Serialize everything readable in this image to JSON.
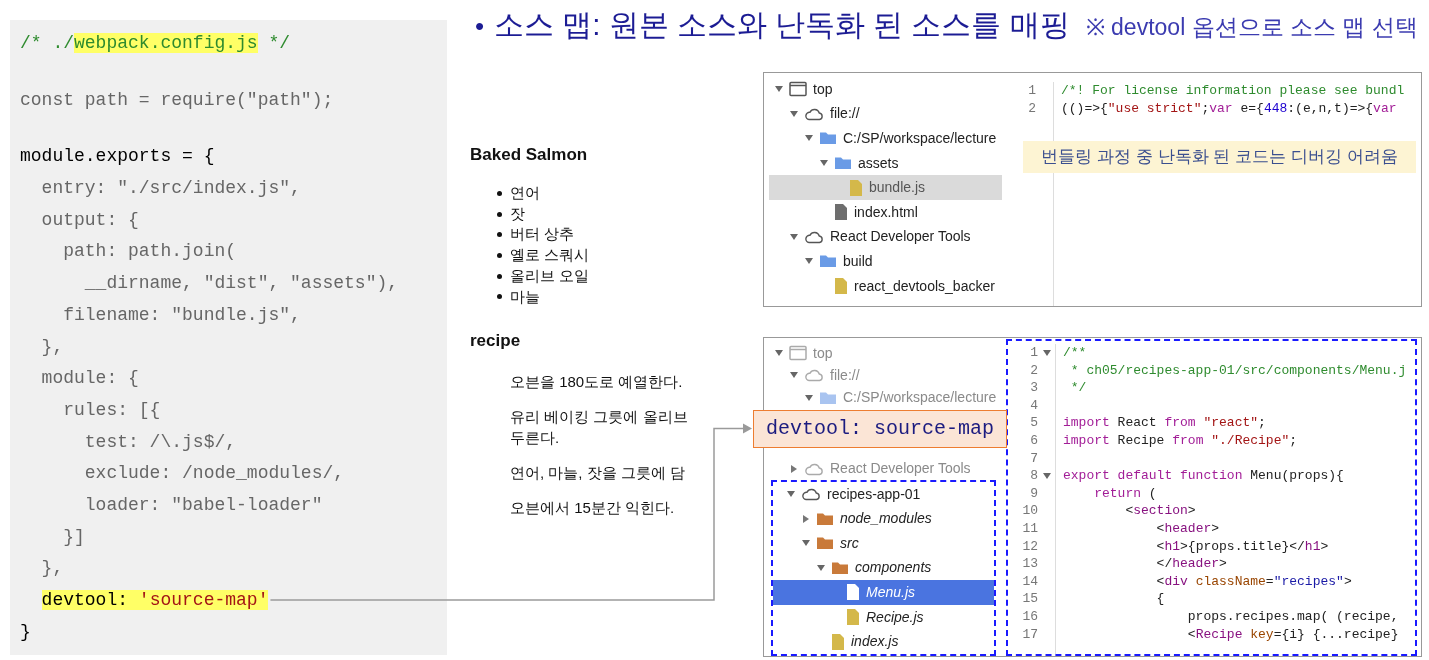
{
  "code_panel": {
    "lines": [
      {
        "tokens": [
          {
            "text": "/* ./",
            "kind": "comment"
          },
          {
            "text": "webpack.config.js",
            "kind": "comment",
            "highlighted": true
          },
          {
            "text": " */",
            "kind": "comment"
          }
        ]
      },
      {
        "kind": "blank"
      },
      {
        "tokens": [
          {
            "text": "const path = require(\"path\");",
            "kind": "dim"
          }
        ]
      },
      {
        "kind": "blank"
      },
      {
        "tokens": [
          {
            "text": "module.exports = {",
            "kind": "normal"
          }
        ]
      },
      {
        "tokens": [
          {
            "text": "  entry: \"./src/index.js\",",
            "kind": "dim"
          }
        ]
      },
      {
        "tokens": [
          {
            "text": "  output: {",
            "kind": "dim"
          }
        ]
      },
      {
        "tokens": [
          {
            "text": "    path: path.join(",
            "kind": "dim"
          }
        ]
      },
      {
        "tokens": [
          {
            "text": "      __dirname, \"dist\", \"assets\"),",
            "kind": "dim"
          }
        ]
      },
      {
        "tokens": [
          {
            "text": "    filename: \"bundle.js\",",
            "kind": "dim"
          }
        ]
      },
      {
        "tokens": [
          {
            "text": "  },",
            "kind": "dim"
          }
        ]
      },
      {
        "tokens": [
          {
            "text": "  module: {",
            "kind": "dim"
          }
        ]
      },
      {
        "tokens": [
          {
            "text": "    rules: [{",
            "kind": "dim"
          }
        ]
      },
      {
        "tokens": [
          {
            "text": "      test: /\\.js$/,",
            "kind": "dim"
          }
        ]
      },
      {
        "tokens": [
          {
            "text": "      exclude: /node_modules/,",
            "kind": "dim"
          }
        ]
      },
      {
        "tokens": [
          {
            "text": "      loader: \"babel-loader\"",
            "kind": "dim"
          }
        ]
      },
      {
        "tokens": [
          {
            "text": "    }]",
            "kind": "dim"
          }
        ]
      },
      {
        "tokens": [
          {
            "text": "  },",
            "kind": "dim"
          }
        ]
      },
      {
        "tokens": [
          {
            "text": "  devtool: ",
            "kind": "normal",
            "highlighted": true
          },
          {
            "text": "'source-map'",
            "kind": "string",
            "highlighted": true
          }
        ]
      },
      {
        "tokens": [
          {
            "text": "}",
            "kind": "normal"
          }
        ]
      }
    ]
  },
  "title": {
    "bullet": "•",
    "text": "소스 맵: 원본 소스와 난독화 된 소스를 매핑",
    "note": "※ devtool 옵션으로 소스 맵 선택"
  },
  "recipe_page": {
    "title": "Baked Salmon",
    "ingredients": [
      "연어",
      "잣",
      "버터 상추",
      "옐로 스쿼시",
      "올리브 오일",
      "마늘"
    ],
    "section_heading": "recipe",
    "steps": [
      {
        "lines": [
          "오븐을 180도로 예열한다."
        ]
      },
      {
        "lines": [
          "유리 베이킹 그릇에 올리브",
          "두른다."
        ]
      },
      {
        "lines": [
          "연어, 마늘, 잣을 그릇에 담"
        ]
      },
      {
        "lines": [
          "오븐에서 15분간 익힌다."
        ]
      }
    ]
  },
  "top_panel": {
    "focused": false,
    "nodes": [
      {
        "label": "top",
        "kind": "frame",
        "expanded": true,
        "selected": false,
        "children": [
          {
            "label": "file://",
            "kind": "cloud",
            "expanded": true,
            "selected": false,
            "children": [
              {
                "label": "C:/SP/workspace/lecture",
                "kind": "folder",
                "color": "#6a9be6",
                "expanded": true,
                "selected": false,
                "children": [
                  {
                    "label": "assets",
                    "kind": "folder",
                    "color": "#6a9be6",
                    "expanded": true,
                    "selected": false,
                    "children": [
                      {
                        "label": "bundle.js",
                        "kind": "file",
                        "color": "#d4b84a",
                        "selected": true
                      }
                    ]
                  },
                  {
                    "label": "index.html",
                    "kind": "file",
                    "color": "#6e6e6e",
                    "selected": false
                  }
                ]
              }
            ]
          },
          {
            "label": "React Developer Tools",
            "kind": "cloud",
            "expanded": true,
            "selected": false,
            "children": [
              {
                "label": "build",
                "kind": "folder",
                "color": "#6a9be6",
                "expanded": true,
                "selected": false,
                "children": [
                  {
                    "label": "react_devtools_backer",
                    "kind": "file",
                    "color": "#d4b84a",
                    "selected": false
                  }
                ]
              }
            ]
          }
        ]
      }
    ],
    "editor": {
      "note": "번들링 과정 중 난독화 된 코드는 디버깅 어려움",
      "lines": [
        {
          "number": "1",
          "tokens": [
            {
              "text": "/*! For license information please see bundl",
              "kind": "comment"
            }
          ]
        },
        {
          "number": "2",
          "tokens": [
            {
              "text": "(()=>{",
              "kind": "plain"
            },
            {
              "text": "\"use strict\"",
              "kind": "string"
            },
            {
              "text": ";",
              "kind": "plain"
            },
            {
              "text": "var",
              "kind": "keyword"
            },
            {
              "text": " e={",
              "kind": "plain"
            },
            {
              "text": "448",
              "kind": "number"
            },
            {
              "text": ":(e,n,t)=>{",
              "kind": "plain"
            },
            {
              "text": "var",
              "kind": "keyword"
            }
          ]
        }
      ]
    }
  },
  "callout": {
    "text": "devtool: source-map"
  },
  "bottom_panel": {
    "focused": true,
    "nodes": [
      {
        "label": "top",
        "kind": "frame",
        "expanded": true,
        "selected": false,
        "faded": true,
        "children": [
          {
            "label": "file://",
            "kind": "cloud",
            "expanded": true,
            "selected": false,
            "faded": true,
            "children": [
              {
                "label": "C:/SP/workspace/lecture",
                "kind": "folder",
                "color": "#a9c4f0",
                "expanded": true,
                "selected": false,
                "faded": true
              }
            ]
          },
          {
            "label": "React Developer Tools",
            "kind": "cloud",
            "expanded": false,
            "selected": false,
            "faded": true
          },
          {
            "label": "recipes-app-01",
            "kind": "cloud",
            "expanded": true,
            "selected": false,
            "framed": true,
            "children": [
              {
                "label": "node_modules",
                "kind": "folder",
                "color": "#c97a3a",
                "expanded": false,
                "selected": false,
                "source_mapped": true
              },
              {
                "label": "src",
                "kind": "folder",
                "color": "#c97a3a",
                "expanded": true,
                "selected": false,
                "source_mapped": true,
                "children": [
                  {
                    "label": "components",
                    "kind": "folder",
                    "color": "#c97a3a",
                    "expanded": true,
                    "selected": false,
                    "source_mapped": true,
                    "children": [
                      {
                        "label": "Menu.js",
                        "kind": "file",
                        "selected": true,
                        "source_mapped": true
                      },
                      {
                        "label": "Recipe.js",
                        "kind": "file",
                        "color": "#d4b84a",
                        "selected": false,
                        "source_mapped": true
                      }
                    ]
                  },
                  {
                    "label": "index.js",
                    "kind": "file",
                    "color": "#d4b84a",
                    "selected": false,
                    "source_mapped": true
                  }
                ]
              }
            ]
          }
        ]
      }
    ],
    "editor": {
      "framed": true,
      "lines": [
        {
          "number": "1",
          "foldable": true,
          "tokens": [
            {
              "text": "/**",
              "kind": "comment"
            }
          ]
        },
        {
          "number": "2",
          "foldable": false,
          "tokens": [
            {
              "text": " * ch05/recipes-app-01/src/components/Menu.j",
              "kind": "comment"
            }
          ]
        },
        {
          "number": "3",
          "foldable": false,
          "tokens": [
            {
              "text": " */",
              "kind": "comment"
            }
          ]
        },
        {
          "number": "4",
          "foldable": false
        },
        {
          "number": "5",
          "foldable": false,
          "tokens": [
            {
              "text": "import",
              "kind": "keyword"
            },
            {
              "text": " React ",
              "kind": "plain"
            },
            {
              "text": "from ",
              "kind": "keyword"
            },
            {
              "text": "\"react\"",
              "kind": "string"
            },
            {
              "text": ";",
              "kind": "plain"
            }
          ]
        },
        {
          "number": "6",
          "foldable": false,
          "tokens": [
            {
              "text": "import",
              "kind": "keyword"
            },
            {
              "text": " Recipe ",
              "kind": "plain"
            },
            {
              "text": "from ",
              "kind": "keyword"
            },
            {
              "text": "\"./Recipe\"",
              "kind": "string"
            },
            {
              "text": ";",
              "kind": "plain"
            }
          ]
        },
        {
          "number": "7",
          "foldable": false
        },
        {
          "number": "8",
          "foldable": true,
          "tokens": [
            {
              "text": "export default function",
              "kind": "keyword"
            },
            {
              "text": " Menu(props){",
              "kind": "plain"
            }
          ]
        },
        {
          "number": "9",
          "foldable": false,
          "tokens": [
            {
              "text": "    return",
              "kind": "keyword"
            },
            {
              "text": " (",
              "kind": "plain"
            }
          ]
        },
        {
          "number": "10",
          "foldable": false,
          "tokens": [
            {
              "text": "        <",
              "kind": "plain"
            },
            {
              "text": "section",
              "kind": "tag"
            },
            {
              "text": ">",
              "kind": "plain"
            }
          ]
        },
        {
          "number": "11",
          "foldable": false,
          "tokens": [
            {
              "text": "            <",
              "kind": "plain"
            },
            {
              "text": "header",
              "kind": "tag"
            },
            {
              "text": ">",
              "kind": "plain"
            }
          ]
        },
        {
          "number": "12",
          "foldable": false,
          "tokens": [
            {
              "text": "            <",
              "kind": "plain"
            },
            {
              "text": "h1",
              "kind": "tag"
            },
            {
              "text": ">{props.title}</",
              "kind": "plain"
            },
            {
              "text": "h1",
              "kind": "tag"
            },
            {
              "text": ">",
              "kind": "plain"
            }
          ]
        },
        {
          "number": "13",
          "foldable": false,
          "tokens": [
            {
              "text": "            </",
              "kind": "plain"
            },
            {
              "text": "header",
              "kind": "tag"
            },
            {
              "text": ">",
              "kind": "plain"
            }
          ]
        },
        {
          "number": "14",
          "foldable": false,
          "tokens": [
            {
              "text": "            <",
              "kind": "plain"
            },
            {
              "text": "div",
              "kind": "tag"
            },
            {
              "text": " className",
              "kind": "attr"
            },
            {
              "text": "=",
              "kind": "plain"
            },
            {
              "text": "\"recipes\"",
              "kind": "value"
            },
            {
              "text": ">",
              "kind": "plain"
            }
          ]
        },
        {
          "number": "15",
          "foldable": false,
          "tokens": [
            {
              "text": "            {",
              "kind": "plain"
            }
          ]
        },
        {
          "number": "16",
          "foldable": false,
          "tokens": [
            {
              "text": "                props.recipes.map( (recipe,",
              "kind": "plain"
            }
          ]
        },
        {
          "number": "17",
          "foldable": false,
          "tokens": [
            {
              "text": "                <",
              "kind": "plain"
            },
            {
              "text": "Recipe",
              "kind": "tag"
            },
            {
              "text": " key",
              "kind": "attr"
            },
            {
              "text": "={i} {...recipe}",
              "kind": "plain"
            }
          ]
        }
      ]
    }
  }
}
